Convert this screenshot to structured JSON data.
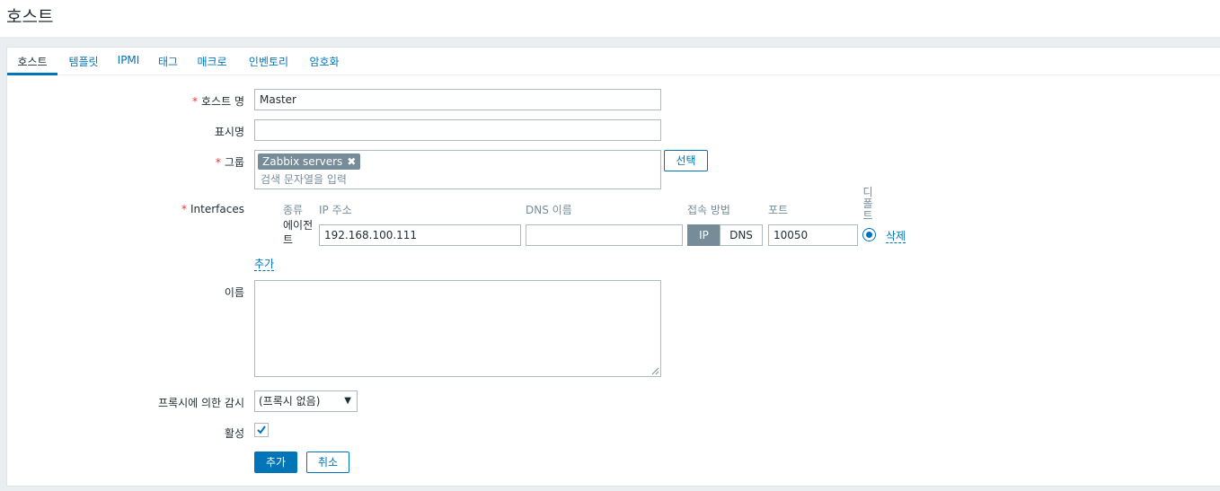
{
  "page": {
    "title": "호스트"
  },
  "tabs": [
    {
      "label": "호스트",
      "active": true
    },
    {
      "label": "템플릿",
      "active": false
    },
    {
      "label": "IPMI",
      "active": false
    },
    {
      "label": "태그",
      "active": false
    },
    {
      "label": "매크로",
      "active": false
    },
    {
      "label": "인벤토리",
      "active": false
    },
    {
      "label": "암호화",
      "active": false
    }
  ],
  "form": {
    "required_mark": "*",
    "host_name": {
      "label": "호스트 명",
      "value": "Master"
    },
    "visible_name": {
      "label": "표시명",
      "value": ""
    },
    "groups": {
      "label": "그룹",
      "selected": [
        "Zabbix servers"
      ],
      "remove_symbol": "✖",
      "placeholder": "검색 문자열을 입력",
      "select_button": "선택"
    },
    "interfaces": {
      "label": "Interfaces",
      "headers": {
        "type": "종류",
        "ip": "IP 주소",
        "dns": "DNS 이름",
        "connect": "접속 방법",
        "port": "포트",
        "default": "디폴트"
      },
      "rows": [
        {
          "type": "에이전트",
          "ip": "192.168.100.111",
          "dns": "",
          "connect_ip": "IP",
          "connect_dns": "DNS",
          "connect_selected": "IP",
          "port": "10050",
          "default": true,
          "remove": "삭제"
        }
      ],
      "add_link": "추가"
    },
    "description": {
      "label": "이름",
      "value": ""
    },
    "proxy": {
      "label": "프록시에 의한 감시",
      "value": "(프록시 없음)"
    },
    "enabled": {
      "label": "활성",
      "checked": true
    },
    "buttons": {
      "add": "추가",
      "cancel": "취소"
    }
  },
  "colors": {
    "accent": "#0275b8",
    "required": "#e33734",
    "chip": "#768d99",
    "background": "#ebeef0"
  }
}
